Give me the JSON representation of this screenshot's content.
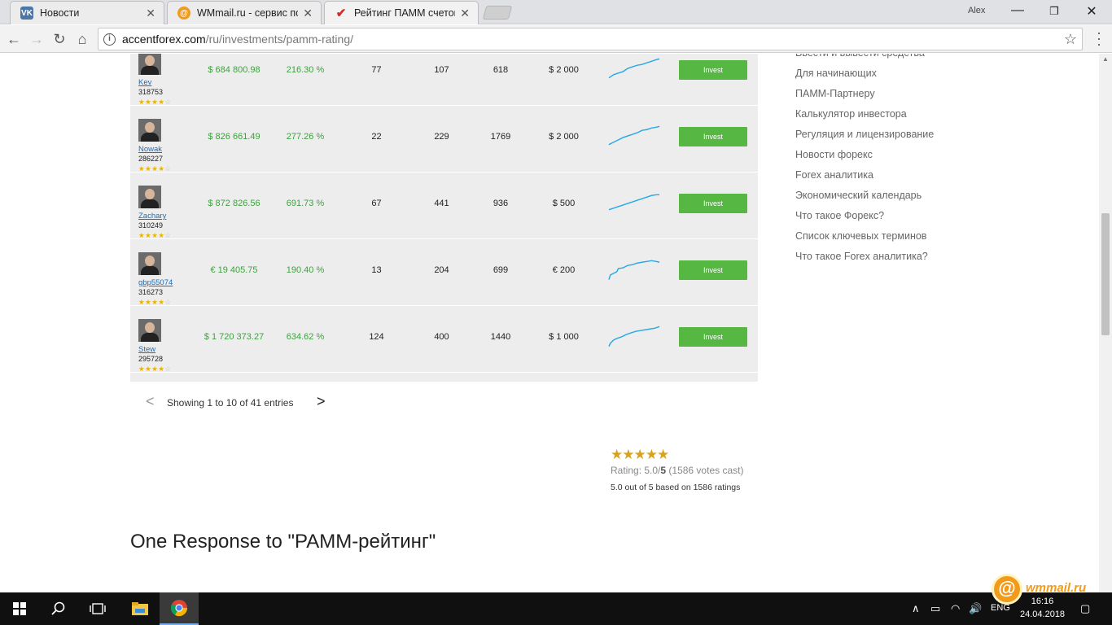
{
  "browser": {
    "tabs": [
      {
        "title": "Новости",
        "favicon": "vk-icon",
        "active": false
      },
      {
        "title": "WMmail.ru - сервис почт",
        "favicon": "wmmail-icon",
        "active": false
      },
      {
        "title": "Рейтинг ПАММ счетов Ал",
        "favicon": "checkmark-icon",
        "active": true
      }
    ],
    "user": "Alex",
    "url_host": "accentforex.com",
    "url_path": "/ru/investments/pamm-rating/"
  },
  "table": {
    "rows": [
      {
        "name": "Kev",
        "id": "318753",
        "stars": 4,
        "balance": "$ 684 800.98",
        "profit": "216.30 %",
        "c1": "77",
        "c2": "107",
        "c3": "618",
        "min": "$ 2 000",
        "invest": "Invest"
      },
      {
        "name": "Nowak",
        "id": "286227",
        "stars": 4,
        "balance": "$ 826 661.49",
        "profit": "277.26 %",
        "c1": "22",
        "c2": "229",
        "c3": "1769",
        "min": "$ 2 000",
        "invest": "Invest"
      },
      {
        "name": "Zachary",
        "id": "310249",
        "stars": 4,
        "balance": "$ 872 826.56",
        "profit": "691.73 %",
        "c1": "67",
        "c2": "441",
        "c3": "936",
        "min": "$ 500",
        "invest": "Invest"
      },
      {
        "name": "gbp55074",
        "id": "316273",
        "stars": 4,
        "balance": "€ 19 405.75",
        "profit": "190.40 %",
        "c1": "13",
        "c2": "204",
        "c3": "699",
        "min": "€ 200",
        "invest": "Invest"
      },
      {
        "name": "Stew",
        "id": "295728",
        "stars": 3.5,
        "balance": "$ 1 720 373.27",
        "profit": "634.62 %",
        "c1": "124",
        "c2": "400",
        "c3": "1440",
        "min": "$ 1 000",
        "invest": "Invest"
      }
    ]
  },
  "pager": {
    "prev": "<",
    "info": "Showing 1 to 10 of 41 entries",
    "next": ">"
  },
  "rating": {
    "stars": "★★★★★",
    "label": "Rating: 5.0/",
    "max": "5",
    "votes": "(1586 votes cast)",
    "summary": "5.0 out of 5 based on 1586 ratings"
  },
  "response_title": "One Response to \"PAMM-рейтинг\"",
  "sidebar": {
    "links": [
      "Ввести и вывести средства",
      "Для начинающих",
      "ПАММ-Партнеру",
      "Калькулятор инвестора",
      "Регуляция и лицензирование",
      "Новости форекс",
      "Forex аналитика",
      "Экономический календарь",
      "Что такое Форекс?",
      "Список ключевых терминов",
      "Что такое Forex аналитика?"
    ]
  },
  "taskbar": {
    "lang": "ENG",
    "time": "16:16",
    "date": "24.04.2018",
    "watermark": "wmmail.ru"
  },
  "colors": {
    "invest_button": "#56b842",
    "sparkline": "#29a9e6",
    "money_text": "#3fa03f",
    "table_bg": "#ededed"
  }
}
